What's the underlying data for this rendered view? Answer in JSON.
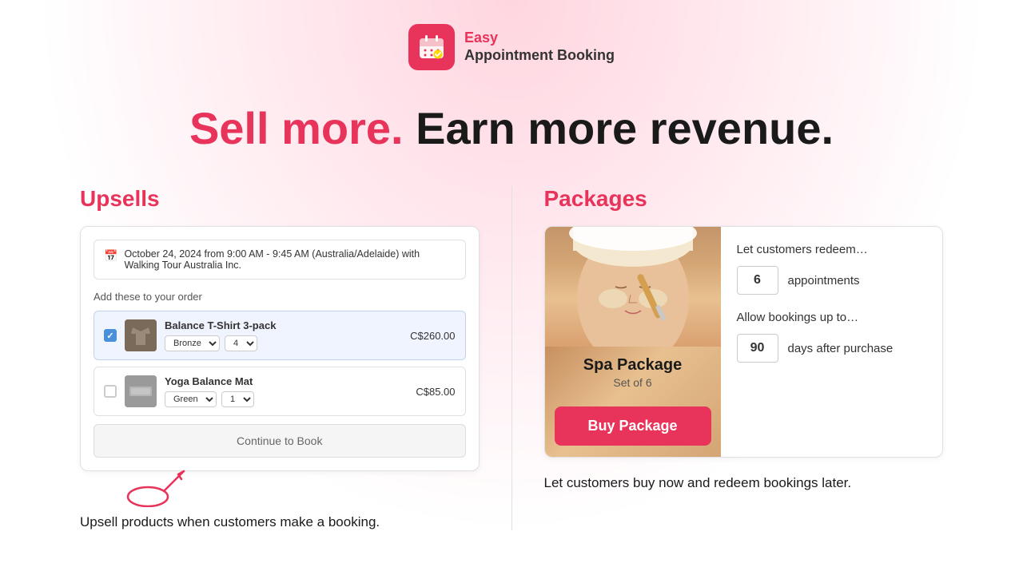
{
  "header": {
    "logo_easy": "Easy",
    "logo_appointment": "Appointment",
    "logo_booking": "Booking"
  },
  "hero": {
    "heading_pink": "Sell more.",
    "heading_dark": " Earn more revenue."
  },
  "upsells": {
    "title": "Upsells",
    "booking_date": "October 24, 2024 from 9:00 AM - 9:45 AM (Australia/Adelaide) with Walking Tour Australia Inc.",
    "add_order_label": "Add these to your order",
    "product1": {
      "name": "Balance T-Shirt 3-pack",
      "variant1": "Bronze",
      "variant2": "4",
      "price": "C$260.00",
      "checked": true
    },
    "product2": {
      "name": "Yoga Balance Mat",
      "variant1": "Green",
      "variant2": "1",
      "price": "C$85.00",
      "checked": false
    },
    "continue_btn": "Continue to Book",
    "description": "Upsell products when customers make a booking."
  },
  "packages": {
    "title": "Packages",
    "spa_name": "Spa Package",
    "spa_set": "Set of 6",
    "buy_btn": "Buy Package",
    "redeem_label": "Let customers redeem…",
    "appointments_count": "6",
    "appointments_label": "appointments",
    "allow_label": "Allow bookings up to…",
    "days_count": "90",
    "days_label": "days after purchase",
    "description": "Let customers buy now and redeem bookings later."
  }
}
